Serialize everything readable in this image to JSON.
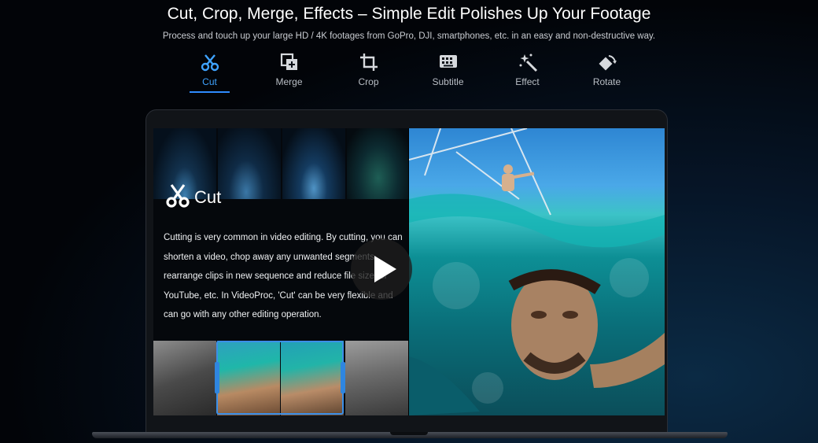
{
  "header": {
    "title": "Cut, Crop, Merge, Effects – Simple Edit Polishes Up Your Footage",
    "subtitle": "Process and touch up your large HD / 4K footages from GoPro, DJI, smartphones, etc. in an easy and non-destructive way."
  },
  "tabs": [
    {
      "label": "Cut",
      "icon": "scissors-icon",
      "active": true
    },
    {
      "label": "Merge",
      "icon": "merge-icon",
      "active": false
    },
    {
      "label": "Crop",
      "icon": "crop-icon",
      "active": false
    },
    {
      "label": "Subtitle",
      "icon": "subtitle-icon",
      "active": false
    },
    {
      "label": "Effect",
      "icon": "magic-wand-icon",
      "active": false
    },
    {
      "label": "Rotate",
      "icon": "rotate-icon",
      "active": false
    }
  ],
  "panel": {
    "heading": "Cut",
    "description": "Cutting is very common in video editing. By cutting, you can shorten a video, chop away any unwanted segments, rearrange clips in new sequence and reduce file size for YouTube, etc. In VideoProc, 'Cut' can be very flexible and can go with any other editing operation."
  },
  "colors": {
    "accent": "#2f8bff",
    "background": "#020408",
    "water": "#0d8f95"
  }
}
